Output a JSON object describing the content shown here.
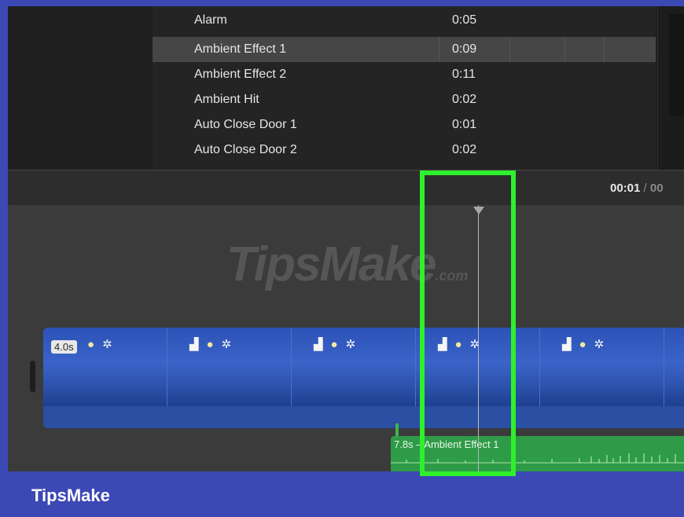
{
  "browser": {
    "rows": [
      {
        "name": "Alarm",
        "duration": "0:05"
      },
      {
        "name": "Ambient Effect 1",
        "duration": "0:09"
      },
      {
        "name": "Ambient Effect 2",
        "duration": "0:11"
      },
      {
        "name": "Ambient Hit",
        "duration": "0:02"
      },
      {
        "name": "Auto Close Door 1",
        "duration": "0:01"
      },
      {
        "name": "Auto Close Door 2",
        "duration": "0:02"
      }
    ],
    "selected_index": 1
  },
  "toolbar": {
    "current_time": "00:01",
    "separator": "/",
    "total_time_partial": "00"
  },
  "timeline": {
    "watermark_text": "TipsMake",
    "watermark_suffix": ".com",
    "video_clip": {
      "duration_badge": "4.0s",
      "thumbnail_icons": [
        "monitor-icon",
        "lightbulb-icon",
        "star-figure-icon"
      ]
    },
    "audio_clip": {
      "label": "7.8s – Ambient Effect 1",
      "color": "#2e9b48"
    }
  },
  "highlight_color": "#2ef02b",
  "brand": {
    "text": "TipsMake",
    "bar_color": "#3c48b4"
  }
}
